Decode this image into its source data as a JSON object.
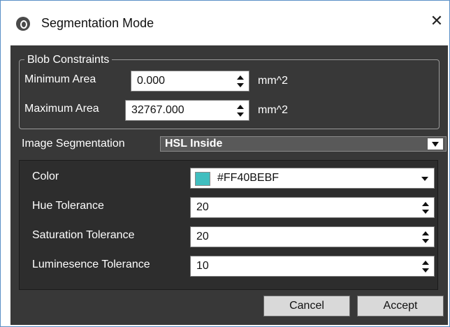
{
  "window": {
    "title": "Segmentation Mode",
    "close_glyph": "✕"
  },
  "blob_constraints": {
    "legend": "Blob Constraints",
    "min_label": "Minimum Area",
    "min_value": "0.000",
    "min_unit": "mm^2",
    "max_label": "Maximum Area",
    "max_value": "32767.000",
    "max_unit": "mm^2"
  },
  "image_segmentation": {
    "label": "Image Segmentation",
    "selected": "HSL Inside"
  },
  "hsl": {
    "color_label": "Color",
    "color_value": "#FF40BEBF",
    "swatch_color": "#40BEBF",
    "hue_label": "Hue Tolerance",
    "hue_value": "20",
    "sat_label": "Saturation Tolerance",
    "sat_value": "20",
    "lum_label": "Luminesence Tolerance",
    "lum_value": "10"
  },
  "buttons": {
    "cancel": "Cancel",
    "accept": "Accept"
  },
  "icons": [
    "app-icon",
    "close-icon",
    "spin-up-icon",
    "spin-down-icon",
    "dropdown-arrow-icon"
  ]
}
